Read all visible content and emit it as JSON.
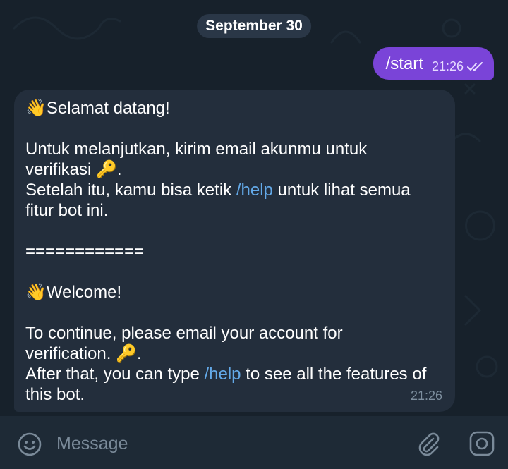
{
  "chat": {
    "date_label": "September 30",
    "outgoing": {
      "text": "/start",
      "time": "21:26",
      "status_icon": "double-check-icon"
    },
    "incoming": {
      "emoji_wave": "👋",
      "emoji_key": "🔑",
      "id_greeting": "Selamat datang!",
      "id_line1": "Untuk melanjutkan, kirim email akunmu untuk",
      "id_line2_text": "verifikasi",
      "id_line3_pre": "Setelah itu, kamu bisa ketik",
      "id_help_cmd": "/help",
      "id_line3_post": "untuk lihat semua",
      "id_line4": "fitur bot ini.",
      "separator": "============",
      "en_greeting": "Welcome!",
      "en_line1": "To continue, please email your account for",
      "en_line2_text": "verification.",
      "en_line3_pre": "After that, you can type",
      "en_help_cmd": "/help",
      "en_line3_post": "to see all the features of",
      "en_line4": "this bot.",
      "time": "21:26"
    }
  },
  "input": {
    "placeholder": "Message",
    "emoji_icon": "emoji-icon",
    "attach_icon": "paperclip-icon",
    "camera_icon": "camera-icon"
  },
  "colors": {
    "chat_bg": "#17212b",
    "outgoing_bubble": "#7a44d8",
    "incoming_bubble": "#232e3c",
    "link": "#63a9e8",
    "input_bar": "#1e2a36"
  }
}
